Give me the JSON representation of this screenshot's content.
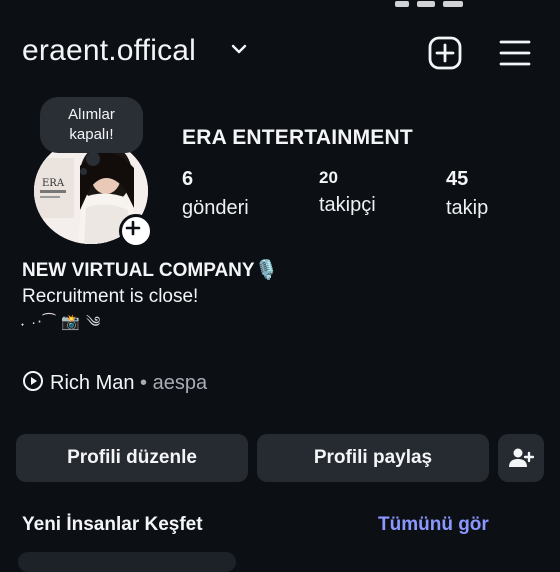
{
  "header": {
    "username": "eraent.offical",
    "create_icon": "plus-square-icon",
    "menu_icon": "hamburger-menu-icon"
  },
  "note": {
    "line1": "Alımlar",
    "line2": "kapalı!"
  },
  "profile": {
    "display_name": "ERA ENTERTAINMENT",
    "stats": {
      "posts": {
        "count": "6",
        "label": "gönderi"
      },
      "followers": {
        "count": "20",
        "label": "takipçi"
      },
      "following": {
        "count": "45",
        "label": "takip"
      }
    }
  },
  "bio": {
    "title": "NEW VIRTUAL COMPANY🎙️",
    "line": "Recruitment is close!",
    "decoration": "˖ ·‧⁀ 📸 ༄"
  },
  "music": {
    "song": "Rich Man",
    "separator": " • ",
    "artist": "aespa"
  },
  "actions": {
    "edit_label": "Profili düzenle",
    "share_label": "Profili paylaş",
    "add_person_icon": "add-person-icon"
  },
  "discover": {
    "title": "Yeni İnsanlar Keşfet",
    "see_all": "Tümünü gör"
  },
  "colors": {
    "background": "#0c0f14",
    "button_bg": "#262a31",
    "link": "#8b98ff"
  }
}
